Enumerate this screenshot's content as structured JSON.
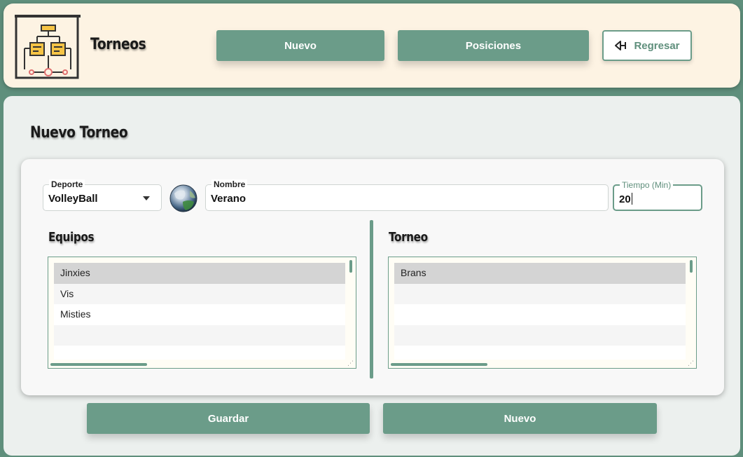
{
  "header": {
    "app_icon": "tournament-bracket-icon",
    "title": "Torneos",
    "buttons": {
      "nuevo": "Nuevo",
      "posiciones": "Posiciones",
      "regresar": "Regresar"
    }
  },
  "form": {
    "title": "Nuevo Torneo",
    "deporte": {
      "label": "Deporte",
      "value": "VolleyBall"
    },
    "sport_icon": "volleyball-globe-icon",
    "nombre": {
      "label": "Nombre",
      "value": "Verano"
    },
    "tiempo": {
      "label": "Tiempo (Min)",
      "value": "20"
    },
    "equipos": {
      "title": "Equipos",
      "items": [
        "Jinxies",
        "Vis",
        "Misties"
      ],
      "selected": "Jinxies"
    },
    "torneo": {
      "title": "Torneo",
      "items": [
        "Brans"
      ],
      "selected": "Brans"
    },
    "buttons": {
      "guardar": "Guardar",
      "nuevo": "Nuevo"
    }
  },
  "colors": {
    "accent": "#6b9c89",
    "background": "#5f8f7c",
    "header_bg": "#fdf3e3",
    "panel_bg": "#ecf0ee",
    "selected_row": "#d4d4d4"
  }
}
